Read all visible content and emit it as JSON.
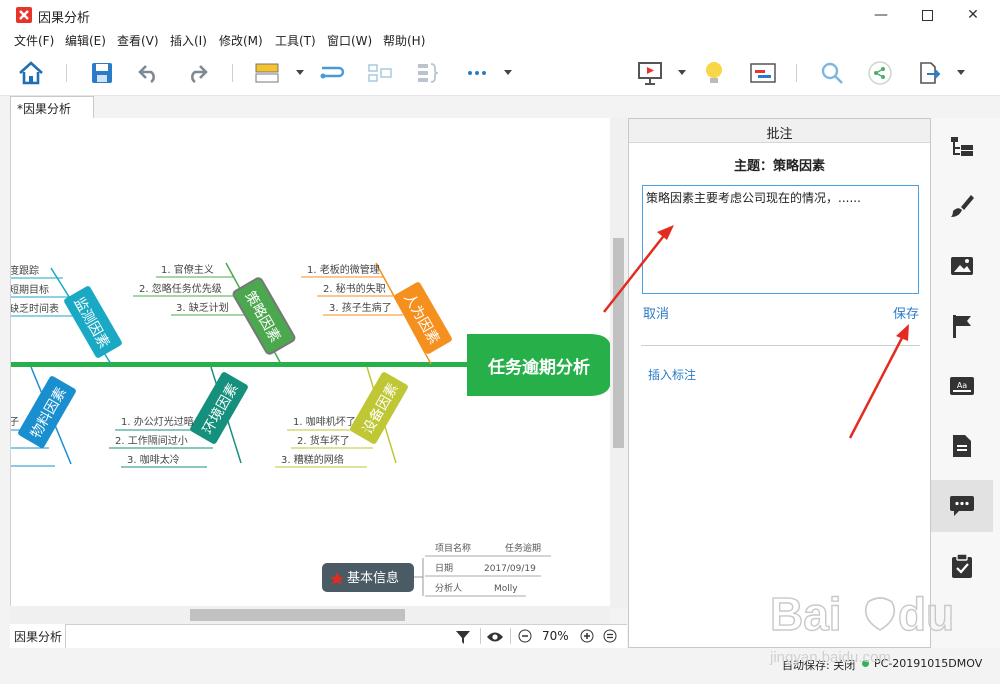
{
  "window": {
    "title": "因果分析",
    "tab": "*因果分析"
  },
  "menu": [
    "文件(F)",
    "编辑(E)",
    "查看(V)",
    "插入(I)",
    "修改(M)",
    "工具(T)",
    "窗口(W)",
    "帮助(H)"
  ],
  "diagram": {
    "head": "任务逾期分析",
    "categories": [
      "监测因素",
      "策略因素",
      "人为因素",
      "物料因素",
      "环境因素",
      "设备因素"
    ],
    "left_cut_items": [
      "度跟踪",
      "短期目标",
      "缺乏时间表",
      "子"
    ],
    "strategy_items": [
      "1. 官僚主义",
      "2. 忽略任务优先级",
      "3. 缺乏计划"
    ],
    "human_items": [
      "1. 老板的微管理",
      "2. 秘书的失职",
      "3. 孩子生病了"
    ],
    "env_items": [
      "1. 办公灯光过暗",
      "2. 工作隔间过小",
      "3. 咖啡太冷"
    ],
    "equip_items": [
      "1. 咖啡机坏了",
      "2. 货车坏了",
      "3. 糟糕的网络"
    ],
    "info_title": "基本信息",
    "info_rows": [
      {
        "label": "项目名称",
        "value": "任务逾期"
      },
      {
        "label": "日期",
        "value": "2017/09/19"
      },
      {
        "label": "分析人",
        "value": "Molly"
      }
    ]
  },
  "status": {
    "sheet": "因果分析",
    "zoom": "70%",
    "autosave": "自动保存: 关闭",
    "pc": "PC-20191015DMOV"
  },
  "panel": {
    "header": "批注",
    "topic": "主题：策略因素",
    "note": "策略因素主要考虑公司现在的情况，......",
    "cancel": "取消",
    "save": "保存",
    "insert": "插入标注"
  },
  "right_icons": [
    "outline-icon",
    "style-brush-icon",
    "image-icon",
    "flag-marker-icon",
    "text-format-icon",
    "notes-icon",
    "comment-icon",
    "task-clipboard-icon"
  ],
  "colors": {
    "head": "#27b04a",
    "monitor": "#1aa9c4",
    "strategy": "#4ba84e",
    "human": "#f5901e",
    "material": "#1a8fd0",
    "env": "#14907c",
    "equip": "#bfc735",
    "annotation": "#e32b20"
  }
}
